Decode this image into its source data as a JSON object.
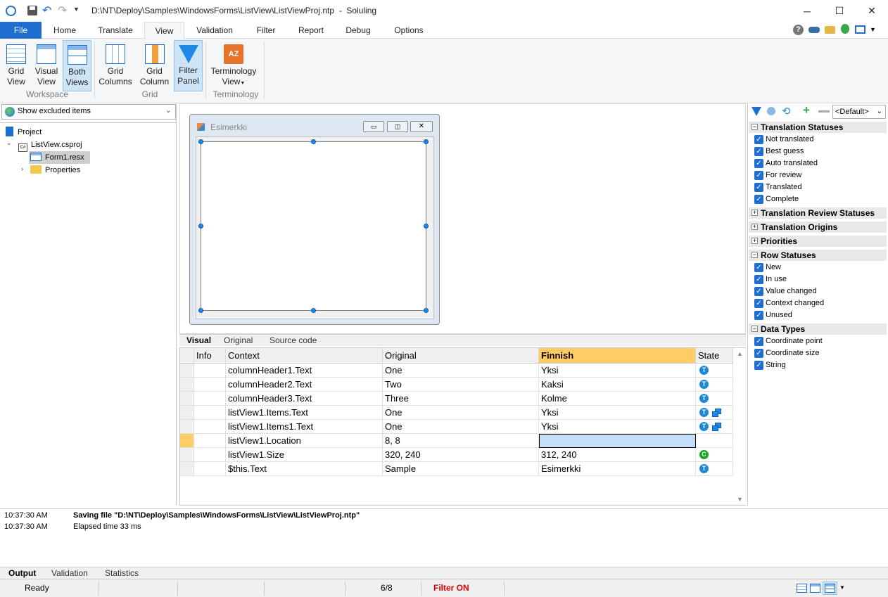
{
  "window": {
    "path": "D:\\NT\\Deploy\\Samples\\WindowsForms\\ListView\\ListViewProj.ntp",
    "separator": "-",
    "app": "Soluling"
  },
  "menu": {
    "tabs": [
      "File",
      "Home",
      "Translate",
      "View",
      "Validation",
      "Filter",
      "Report",
      "Debug",
      "Options"
    ],
    "active": "View"
  },
  "ribbon": {
    "buttons": [
      {
        "l1": "Grid",
        "l2": "View"
      },
      {
        "l1": "Visual",
        "l2": "View"
      },
      {
        "l1": "Both",
        "l2": "Views"
      },
      {
        "l1": "Grid",
        "l2": "Columns"
      },
      {
        "l1": "Grid",
        "l2": "Column"
      },
      {
        "l1": "Filter",
        "l2": "Panel"
      },
      {
        "l1": "Terminology",
        "l2": "View"
      }
    ],
    "groups": [
      "Workspace",
      "Grid",
      "Terminology"
    ]
  },
  "left": {
    "combo": "Show excluded items",
    "tree": [
      "Project",
      "ListView.csproj",
      "Form1.resx",
      "Properties"
    ]
  },
  "visual": {
    "form_title": "Esimerkki",
    "tabs": [
      "Visual",
      "Original",
      "Source code"
    ]
  },
  "grid": {
    "headers": [
      "Info",
      "Context",
      "Original",
      "Finnish",
      "State"
    ],
    "rows": [
      {
        "context": "columnHeader1.Text",
        "original": "One",
        "finnish": "Yksi",
        "state": "T",
        "copy": false
      },
      {
        "context": "columnHeader2.Text",
        "original": "Two",
        "finnish": "Kaksi",
        "state": "T",
        "copy": false
      },
      {
        "context": "columnHeader3.Text",
        "original": "Three",
        "finnish": "Kolme",
        "state": "T",
        "copy": false
      },
      {
        "context": "listView1.Items.Text",
        "original": "One",
        "finnish": "Yksi",
        "state": "T",
        "copy": true
      },
      {
        "context": "listView1.Items1.Text",
        "original": "One",
        "finnish": "Yksi",
        "state": "T",
        "copy": true
      },
      {
        "context": "listView1.Location",
        "original": "8, 8",
        "finnish": "",
        "state": "",
        "copy": false
      },
      {
        "context": "listView1.Size",
        "original": "320, 240",
        "finnish": "312, 240",
        "state": "C",
        "copy": false
      },
      {
        "context": "$this.Text",
        "original": "Sample",
        "finnish": "Esimerkki",
        "state": "T",
        "copy": false
      }
    ],
    "selected_row": 5
  },
  "filter": {
    "preset": "<Default>",
    "groups": [
      {
        "name": "Translation Statuses",
        "expanded": true,
        "items": [
          "Not translated",
          "Best guess",
          "Auto translated",
          "For review",
          "Translated",
          "Complete"
        ]
      },
      {
        "name": "Translation Review Statuses",
        "expanded": false,
        "items": []
      },
      {
        "name": "Translation Origins",
        "expanded": false,
        "items": []
      },
      {
        "name": "Priorities",
        "expanded": false,
        "items": []
      },
      {
        "name": "Row Statuses",
        "expanded": true,
        "items": [
          "New",
          "In use",
          "Value changed",
          "Context changed",
          "Unused"
        ]
      },
      {
        "name": "Data Types",
        "expanded": true,
        "items": [
          "Coordinate point",
          "Coordinate size",
          "String"
        ]
      }
    ]
  },
  "output": {
    "lines": [
      {
        "time": "10:37:30 AM",
        "text": "Saving file \"D:\\NT\\Deploy\\Samples\\WindowsForms\\ListView\\ListViewProj.ntp\"",
        "bold": true
      },
      {
        "time": "10:37:30 AM",
        "text": "Elapsed time 33 ms",
        "bold": false
      }
    ],
    "tabs": [
      "Output",
      "Validation",
      "Statistics"
    ]
  },
  "status": {
    "ready": "Ready",
    "count": "6/8",
    "filter": "Filter ON"
  },
  "colors": {
    "accent": "#1e6fd0",
    "finnish_header": "#ffcc66",
    "filter_on": "#e00000",
    "selected_cell": "#c5def7"
  }
}
